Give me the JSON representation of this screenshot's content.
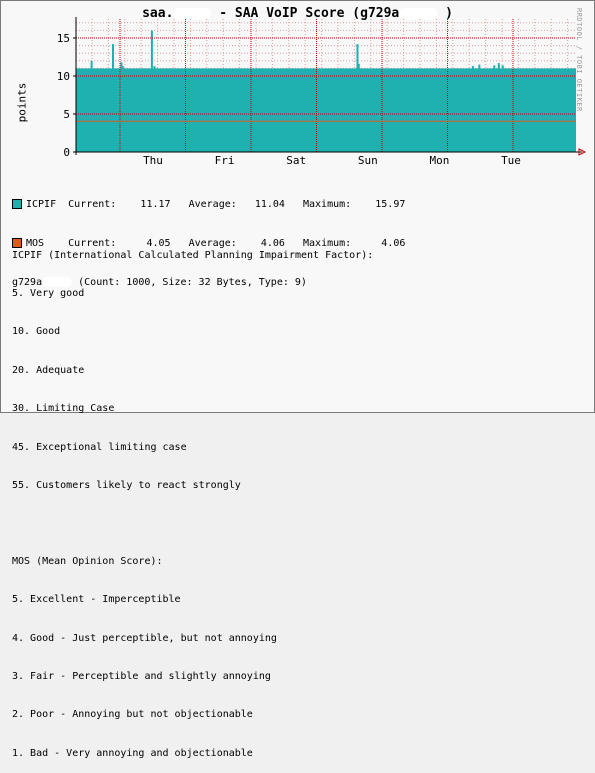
{
  "header": {
    "title_pre": "saa.",
    "title_mid": " - SAA VoIP Score (g729a",
    "title_post": " )"
  },
  "watermark": "RRDTOOL / TOBI OETIKER",
  "chart_data": {
    "type": "area",
    "ylabel": "points",
    "ylim": [
      0,
      17.5
    ],
    "yticks": [
      0,
      5,
      10,
      15
    ],
    "x_categories": [
      "Thu",
      "Fri",
      "Sat",
      "Sun",
      "Mon",
      "Tue"
    ],
    "series": [
      {
        "name": "ICPIF",
        "color": "#1fb0b0",
        "baseline": 11.0,
        "spikes": [
          {
            "day_fraction": 0.04,
            "value": 12.0
          },
          {
            "day_fraction": 0.37,
            "value": 14.2
          },
          {
            "day_fraction": 0.5,
            "value": 11.8
          },
          {
            "day_fraction": 0.52,
            "value": 11.3
          },
          {
            "day_fraction": 0.97,
            "value": 15.97
          },
          {
            "day_fraction": 1.01,
            "value": 11.3
          },
          {
            "day_fraction": 4.14,
            "value": 14.2
          },
          {
            "day_fraction": 4.16,
            "value": 11.6
          },
          {
            "day_fraction": 5.92,
            "value": 11.3
          },
          {
            "day_fraction": 6.02,
            "value": 11.5
          },
          {
            "day_fraction": 6.25,
            "value": 11.4
          },
          {
            "day_fraction": 6.32,
            "value": 11.7
          },
          {
            "day_fraction": 6.38,
            "value": 11.4
          }
        ],
        "current": "11.17",
        "average": "11.04",
        "maximum": "15.97"
      },
      {
        "name": "MOS",
        "color": "#e05a20",
        "line_value": 4.05,
        "current": "4.05",
        "average": "4.06",
        "maximum": "4.06"
      }
    ],
    "colors": {
      "grid_major": "#c00000",
      "grid_minor": "#d8a0a0",
      "axis": "#000000",
      "arrow": "#c00000"
    }
  },
  "legend": {
    "icpif": {
      "name": "ICPIF",
      "current_label": "Current:",
      "average_label": "Average:",
      "maximum_label": "Maximum:"
    },
    "mos": {
      "name": "MOS",
      "current_label": "Current:",
      "average_label": "Average:",
      "maximum_label": "Maximum:"
    },
    "info_pre": "g729a",
    "info_post": "(Count: 1000, Size: 32 Bytes, Type: 9)"
  },
  "icpif_desc": {
    "heading": "ICPIF (International Calculated Planning Impairment Factor):",
    "lines": [
      "5. Very good",
      "10. Good",
      "20. Adequate",
      "30. Limiting Case",
      "45. Exceptional limiting case",
      "55. Customers likely to react strongly"
    ]
  },
  "mos_desc": {
    "heading": "MOS (Mean Opinion Score):",
    "lines": [
      "5. Excellent - Imperceptible",
      "4. Good - Just perceptible, but not annoying",
      "3. Fair - Perceptible and slightly annoying",
      "2. Poor - Annoying but not objectionable",
      "1. Bad - Very annoying and objectionable"
    ]
  }
}
